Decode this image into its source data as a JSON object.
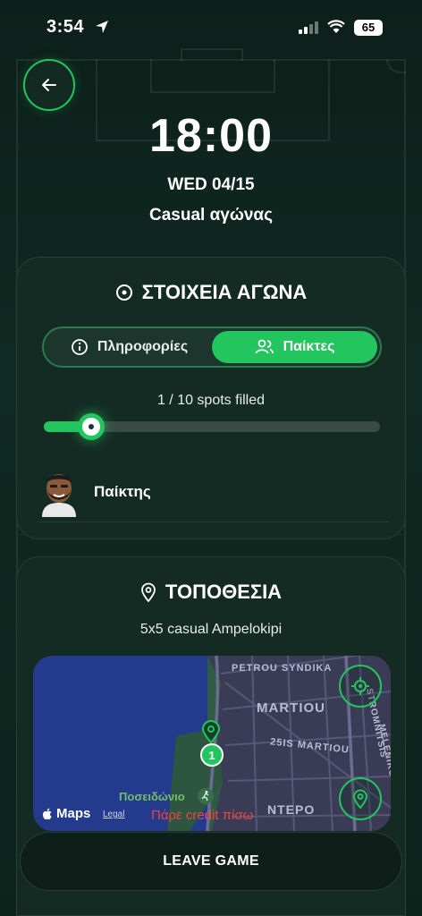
{
  "status_bar": {
    "time": "3:54",
    "battery": "65"
  },
  "match": {
    "time": "18:00",
    "date": "WED 04/15",
    "type": "Casual αγώνας"
  },
  "details": {
    "title": "ΣΤΟΙΧΕΙΑ ΑΓΩΝΑ",
    "tabs": [
      {
        "label": "Πληροφορίες",
        "active": false
      },
      {
        "label": "Παίκτες",
        "active": true
      }
    ],
    "spots_text": "1 / 10 spots filled",
    "spots_filled": 1,
    "spots_total": 10,
    "players": [
      {
        "name": "Παίκτης"
      }
    ]
  },
  "location": {
    "title": "ΤΟΠΟΘΕΣΙΑ",
    "venue": "5x5 casual Ampelokipi",
    "map": {
      "streets": [
        "PETROU SYNDIKA",
        "MARTIOU",
        "25IS MARTIOU",
        "STROMNITSIS",
        "MELENIKOU",
        "NTEPO"
      ],
      "poi": "Ποσειδώνιο",
      "pin_number": "1",
      "apple_maps": "Maps",
      "legal": "Legal",
      "credit": "Πάρε credit πίσω"
    }
  },
  "actions": {
    "leave": "LEAVE GAME"
  },
  "colors": {
    "accent": "#22c55e",
    "card": "#142b24",
    "danger": "#ef4444"
  }
}
